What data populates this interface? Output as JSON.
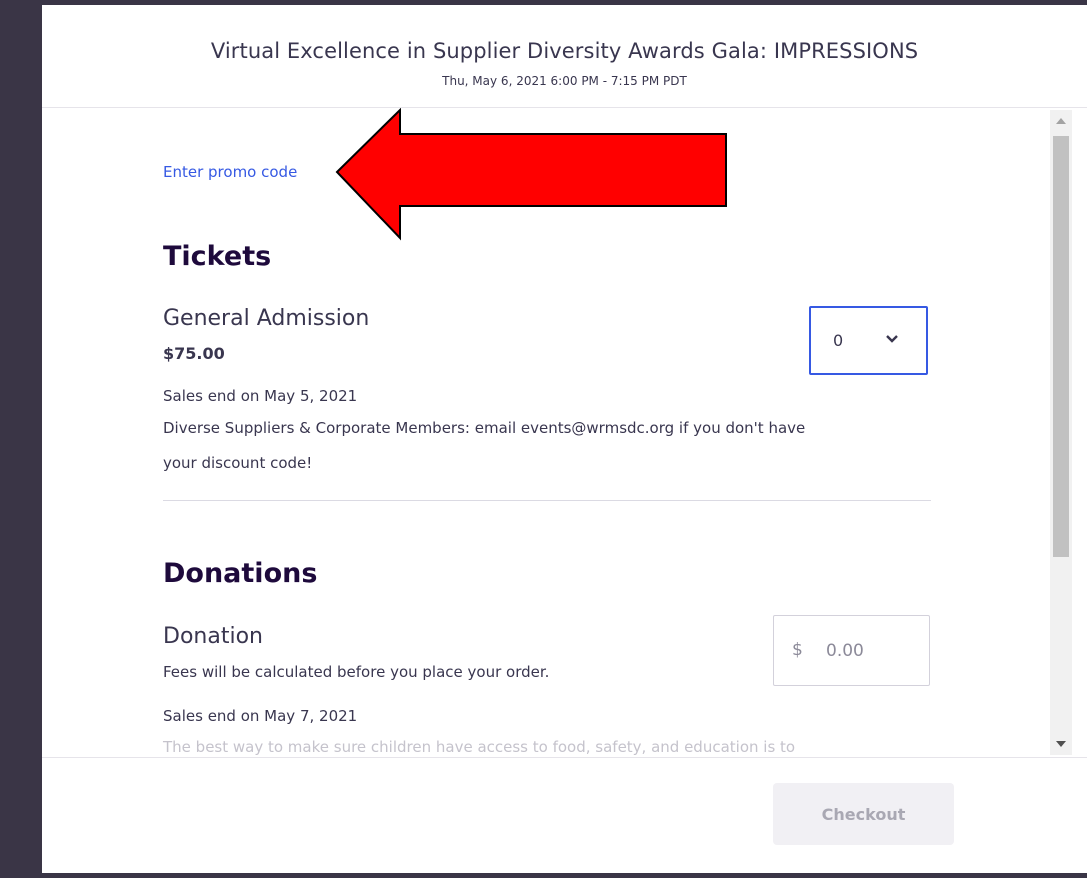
{
  "event": {
    "title": "Virtual Excellence in Supplier Diversity Awards Gala: IMPRESSIONS",
    "date": "Thu, May 6, 2021 6:00 PM - 7:15 PM PDT"
  },
  "promo": {
    "link_label": "Enter promo code"
  },
  "annotation": {
    "arrow_icon": "red-left-arrow",
    "arrow_color": "#ff0000"
  },
  "tickets": {
    "heading": "Tickets",
    "items": [
      {
        "name": "General Admission",
        "price": "$75.00",
        "quantity": "0",
        "sales_end": "Sales end on May 5, 2021",
        "description_line1": "Diverse Suppliers & Corporate Members: email events@wrmsdc.org if you don't have",
        "description_line2": "your discount code!"
      }
    ]
  },
  "donations": {
    "heading": "Donations",
    "items": [
      {
        "name": "Donation",
        "fee_note": "Fees will be calculated before you place your order.",
        "currency_symbol": "$",
        "amount_placeholder": "0.00",
        "sales_end": "Sales end on May 7, 2021",
        "description": "The best way to make sure children have access to food, safety, and education is to"
      }
    ]
  },
  "footer": {
    "checkout_label": "Checkout"
  },
  "colors": {
    "accent": "#3659e3",
    "heading": "#1e0a3c",
    "text": "#39364f",
    "backdrop": "#3a3546"
  }
}
